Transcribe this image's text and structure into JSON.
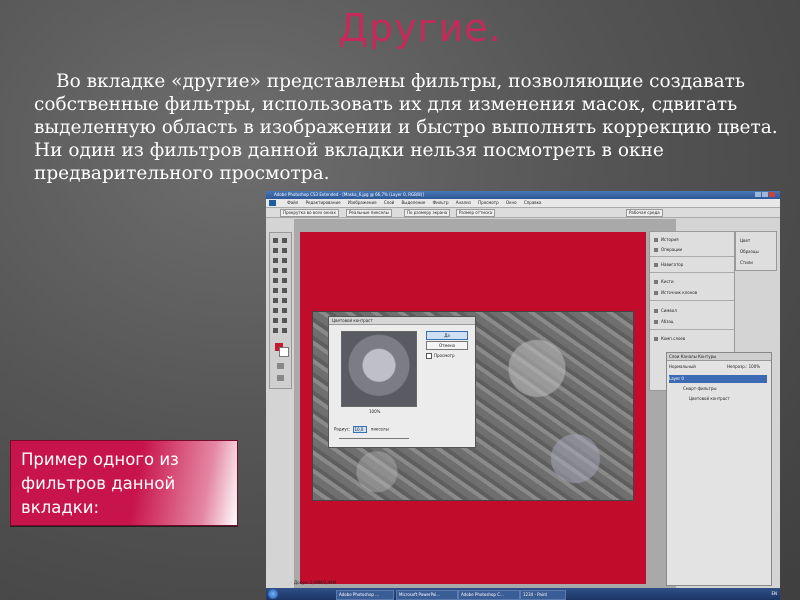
{
  "slide": {
    "title": "Другие.",
    "paragraph": "Во вкладке «другие» представлены фильтры, позволяющие создавать собственные фильтры, использовать их для изменения масок, сдвигать выделенную область в изображении и быстро выполнять коррекцию цвета. Ни один из фильтров данной вкладки нельзя посмотреть в окне предварительного просмотра.",
    "caption": "Пример одного из фильтров данной вкладки:"
  },
  "photoshop": {
    "window_title": "Adobe Photoshop CS3 Extended - [Maska_6.jpg @ 66,7% (Layer 0, RGB/8)]",
    "menu": [
      "Файл",
      "Редактирование",
      "Изображение",
      "Слой",
      "Выделение",
      "Фильтр",
      "Анализ",
      "Просмотр",
      "Окно",
      "Справка"
    ],
    "options": [
      "Прокрутка во всех окнах",
      "Реальные пикселы",
      "По размеру экрана",
      "Размер оттиска"
    ],
    "workspace": "Рабочая среда",
    "dialog": {
      "title": "Цветовой контраст",
      "ok": "Да",
      "cancel": "Отмена",
      "preview": "Просмотр",
      "zoom": "100%",
      "radius_label": "Радиус:",
      "radius_value": "10,0",
      "radius_unit": "пикселы"
    },
    "status": "Докум: 2,49М/2,49М",
    "panel_right_a": [
      "История",
      "Операции",
      "Навигатор",
      "Кисти",
      "Источник клонов",
      "Символ",
      "Абзац",
      "Комп.слоев"
    ],
    "panel_right_b": [
      "Цвет",
      "Образцы",
      "Стили"
    ],
    "layers": {
      "tabs": "Слои Каналы Контуры",
      "mode": "Нормальный",
      "opacity": "Непрозр.: 100%",
      "rows": [
        "Layer 0",
        "Смарт-фильтры",
        "Цветовой контраст"
      ]
    },
    "taskbar": [
      "Adobe Photoshop ...",
      "Microsoft PowerPoi...",
      "Adobe Photoshop C...",
      "1234 - Paint"
    ],
    "clock": "EN"
  }
}
